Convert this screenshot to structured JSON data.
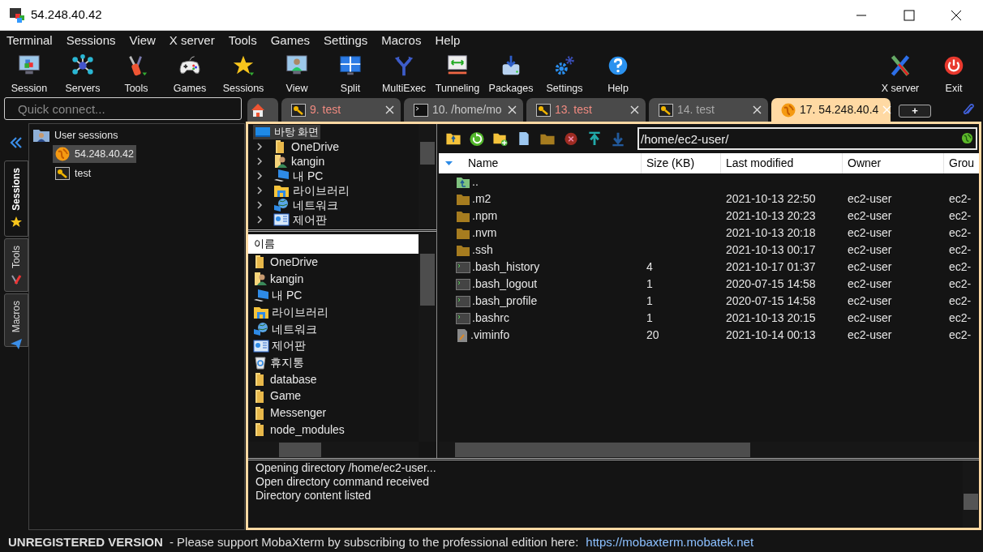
{
  "window": {
    "title": "54.248.40.42"
  },
  "menu": [
    "Terminal",
    "Sessions",
    "View",
    "X server",
    "Tools",
    "Games",
    "Settings",
    "Macros",
    "Help"
  ],
  "toolbar": [
    "Session",
    "Servers",
    "Tools",
    "Games",
    "Sessions",
    "View",
    "Split",
    "MultiExec",
    "Tunneling",
    "Packages",
    "Settings",
    "Help"
  ],
  "toolbar_right": [
    "X server",
    "Exit"
  ],
  "quick_connect": {
    "placeholder": "Quick connect..."
  },
  "tabs": [
    {
      "kind": "home",
      "selected": false
    },
    {
      "kind": "key",
      "label": "9. test",
      "color": "#f08a80",
      "selected": false
    },
    {
      "kind": "terminal",
      "label": "10. /home/mo",
      "color": "#c8c8c8",
      "selected": false
    },
    {
      "kind": "key",
      "label": "13. test",
      "color": "#f08a80",
      "selected": false
    },
    {
      "kind": "key",
      "label": "14. test",
      "color": "#a8a8a8",
      "selected": false
    },
    {
      "kind": "globe",
      "label": "17. 54.248.40.4",
      "color": "#111111",
      "selected": true
    }
  ],
  "new_tab": "+",
  "side_tabs": [
    {
      "label": "Sessions",
      "selected": true
    },
    {
      "label": "Tools",
      "selected": false
    },
    {
      "label": "Macros",
      "selected": false
    }
  ],
  "sessions_tree": {
    "label": "User sessions",
    "children": [
      {
        "kind": "globe",
        "label": "54.248.40.42",
        "selected": true
      },
      {
        "kind": "key",
        "label": "test",
        "selected": false
      }
    ]
  },
  "folder_tree": {
    "label": "바탕 화면",
    "selected": true,
    "children": [
      {
        "kind": "folder",
        "label": "OneDrive",
        "expanded": false
      },
      {
        "kind": "user",
        "label": "kangin",
        "expanded": false
      },
      {
        "kind": "pc",
        "label": "내 PC",
        "expanded": false
      },
      {
        "kind": "library",
        "label": "라이브러리",
        "expanded": false
      },
      {
        "kind": "network",
        "label": "네트워크",
        "expanded": false
      },
      {
        "kind": "control",
        "label": "제어판",
        "expanded": false
      }
    ]
  },
  "local_list": {
    "column": "이름",
    "items": [
      {
        "kind": "folder",
        "label": "OneDrive"
      },
      {
        "kind": "user",
        "label": "kangin"
      },
      {
        "kind": "pc",
        "label": "내 PC"
      },
      {
        "kind": "library",
        "label": "라이브러리"
      },
      {
        "kind": "network",
        "label": "네트워크"
      },
      {
        "kind": "control",
        "label": "제어판"
      },
      {
        "kind": "trash",
        "label": "휴지통"
      },
      {
        "kind": "folder",
        "label": "database"
      },
      {
        "kind": "folder",
        "label": "Game"
      },
      {
        "kind": "folder",
        "label": "Messenger"
      },
      {
        "kind": "folder",
        "label": "node_modules"
      }
    ]
  },
  "remote": {
    "path": "/home/ec2-user/",
    "columns": [
      "Name",
      "Size (KB)",
      "Last modified",
      "Owner",
      "Grou"
    ],
    "rows": [
      {
        "kind": "parent",
        "cells": [
          ".."
        ]
      },
      {
        "kind": "folder",
        "cells": [
          ".m2",
          "",
          "2021-10-13 22:50",
          "ec2-user",
          "ec2-"
        ]
      },
      {
        "kind": "folder",
        "cells": [
          ".npm",
          "",
          "2021-10-13 20:23",
          "ec2-user",
          "ec2-"
        ]
      },
      {
        "kind": "folder",
        "cells": [
          ".nvm",
          "",
          "2021-10-13 20:18",
          "ec2-user",
          "ec2-"
        ]
      },
      {
        "kind": "folder",
        "cells": [
          ".ssh",
          "",
          "2021-10-13 00:17",
          "ec2-user",
          "ec2-"
        ]
      },
      {
        "kind": "script",
        "cells": [
          ".bash_history",
          "4",
          "2021-10-17 01:37",
          "ec2-user",
          "ec2-"
        ]
      },
      {
        "kind": "script",
        "cells": [
          ".bash_logout",
          "1",
          "2020-07-15 14:58",
          "ec2-user",
          "ec2-"
        ]
      },
      {
        "kind": "script",
        "cells": [
          ".bash_profile",
          "1",
          "2020-07-15 14:58",
          "ec2-user",
          "ec2-"
        ]
      },
      {
        "kind": "script",
        "cells": [
          ".bashrc",
          "1",
          "2021-10-13 20:15",
          "ec2-user",
          "ec2-"
        ]
      },
      {
        "kind": "doc",
        "cells": [
          ".viminfo",
          "20",
          "2021-10-14 00:13",
          "ec2-user",
          "ec2-"
        ]
      }
    ]
  },
  "log": [
    "Opening directory /home/ec2-user...",
    "Open directory command received",
    "Directory content listed"
  ],
  "status_bar": {
    "notice": "UNREGISTERED VERSION",
    "message": "-  Please support MobaXterm by subscribing to the professional edition here:",
    "link": "https://mobaxterm.mobatek.net"
  }
}
